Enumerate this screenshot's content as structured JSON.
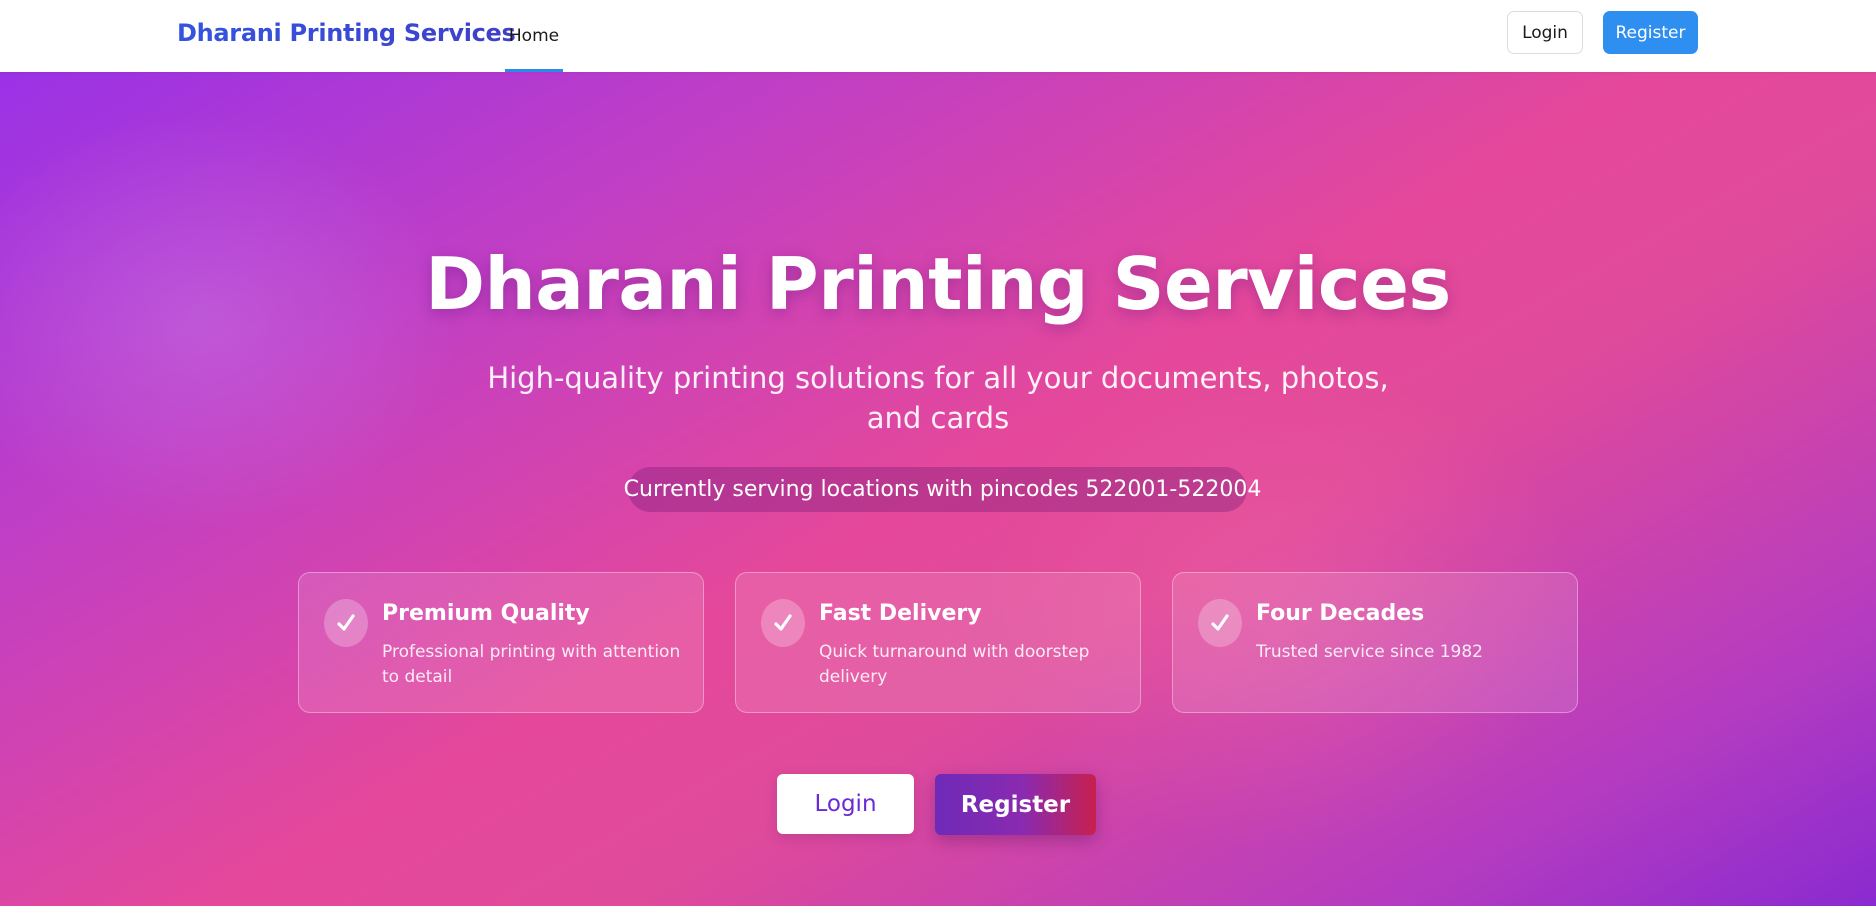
{
  "header": {
    "brand": "Dharani Printing Services",
    "nav": [
      {
        "label": "Home",
        "active": true
      }
    ],
    "login_label": "Login",
    "register_label": "Register",
    "colors": {
      "brand": "#3355e0",
      "active_tab_underline": "#2c8ae8",
      "register_bg": "#2e8ff0"
    }
  },
  "hero": {
    "title": "Dharani Printing Services",
    "subtitle": "High-quality printing solutions for all your documents, photos, and cards",
    "service_area": "Currently serving locations with pincodes 522001-522004",
    "features": [
      {
        "icon": "check-icon",
        "title": "Premium Quality",
        "description": "Professional printing with attention to detail"
      },
      {
        "icon": "check-icon",
        "title": "Fast Delivery",
        "description": "Quick turnaround with doorstep delivery"
      },
      {
        "icon": "check-icon",
        "title": "Four Decades",
        "description": "Trusted service since 1982"
      }
    ],
    "login_label": "Login",
    "register_label": "Register",
    "colors": {
      "gradient_start": "#9a32e6",
      "gradient_mid": "#e5489a",
      "gradient_end": "#8a2ad0"
    }
  }
}
